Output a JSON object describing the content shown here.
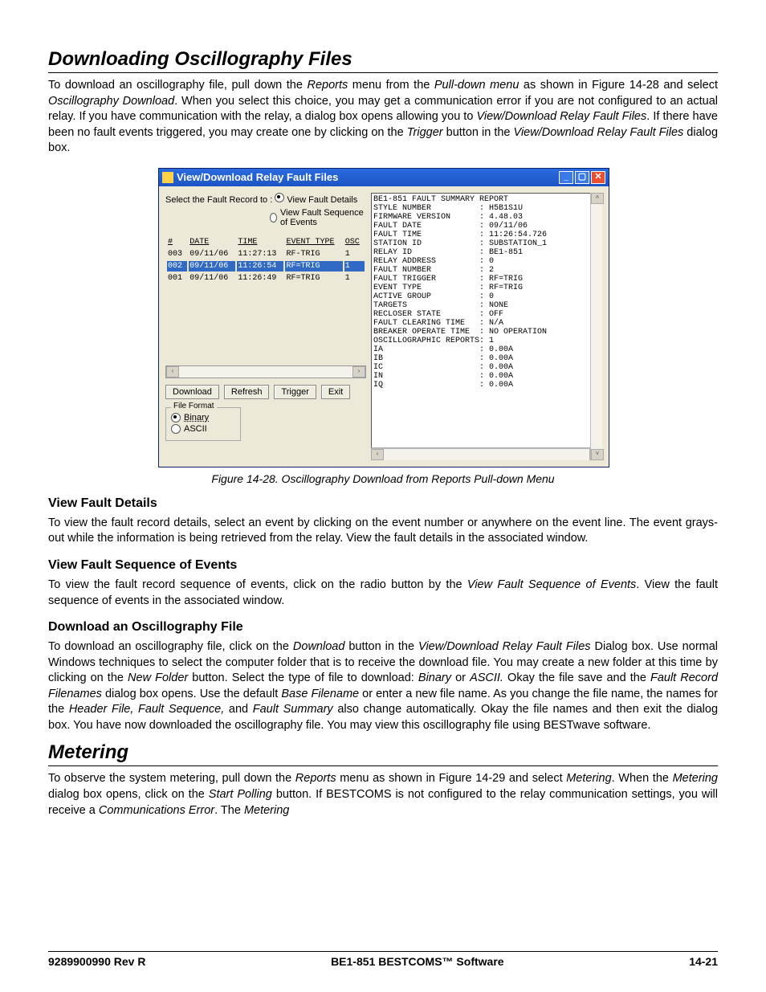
{
  "headings": {
    "h1": "Downloading Oscillography Files",
    "h2": "Metering",
    "sub1": "View Fault Details",
    "sub2": "View Fault Sequence of Events",
    "sub3": "Download an Oscillography File"
  },
  "paragraphs": {
    "intro": "To download an oscillography file, pull down the Reports menu from the Pull-down menu as shown in Figure 14-28 and select Oscillography Download. When you select this choice, you may get a communication error if you are not configured to an actual relay. If you have communication with the relay, a dialog box opens allowing you to View/Download Relay Fault Files. If there have been no fault events triggered, you may create one by clicking on the Trigger button in the View/Download Relay Fault Files dialog box.",
    "vfd": "To view the fault record details, select an event by clicking on the event number or anywhere on the event line. The event grays-out while the information is being retrieved from the relay. View the fault details in the associated window.",
    "vfse": "To view the fault record sequence of events, click on the radio button by the View Fault Sequence of Events. View the fault sequence of events in the associated window.",
    "dof": "To download an oscillography file, click on the Download button in the View/Download Relay Fault Files Dialog box. Use normal Windows techniques to select the computer folder that is to receive the download file. You may create a new folder at this time by clicking on the New Folder button. Select the type of file to download: Binary or ASCII. Okay the file save and the Fault Record Filenames dialog box opens. Use the default Base Filename or enter a new file name. As you change the file name, the names for the Header File, Fault Sequence, and Fault Summary also change automatically. Okay the file names and then exit the dialog box. You have now downloaded the oscillography file. You may view this oscillography file using BESTwave software.",
    "met": "To observe the system metering, pull down the Reports menu as shown in Figure 14-29 and select Metering. When the Metering dialog box opens, click on the Start Polling button. If BESTCOMS is not configured to the relay communication settings, you will receive a Communications Error. The Metering"
  },
  "figcaption": "Figure 14-28. Oscillography Download from Reports Pull-down Menu",
  "dialog": {
    "title": "View/Download Relay Fault Files",
    "select_label": "Select the Fault Record to :",
    "radio1": "View Fault Details",
    "radio2": "View Fault Sequence of Events",
    "cols": {
      "num": "#",
      "date": "DATE",
      "time": "TIME",
      "event": "EVENT TYPE",
      "osc": "OSC"
    },
    "rows": [
      {
        "num": "003",
        "date": "09/11/06",
        "time": "11:27:13",
        "event": "RF-TRIG",
        "osc": "1",
        "selected": false
      },
      {
        "num": "002",
        "date": "09/11/06",
        "time": "11:26:54",
        "event": "RF=TRIG",
        "osc": "1",
        "selected": true
      },
      {
        "num": "001",
        "date": "09/11/06",
        "time": "11:26:49",
        "event": "RF=TRIG",
        "osc": "1",
        "selected": false
      }
    ],
    "buttons": {
      "download": "Download",
      "refresh": "Refresh",
      "trigger": "Trigger",
      "exit": "Exit"
    },
    "file_format": {
      "legend": "File Format",
      "opt1": "Binary",
      "opt2": "ASCII"
    },
    "report": "BE1-851 FAULT SUMMARY REPORT\nSTYLE NUMBER          : H5B1S1U\nFIRMWARE VERSION      : 4.48.03\nFAULT DATE            : 09/11/06\nFAULT TIME            : 11:26:54.726\nSTATION ID            : SUBSTATION_1\nRELAY ID              : BE1-851\nRELAY ADDRESS         : 0\nFAULT NUMBER          : 2\nFAULT TRIGGER         : RF=TRIG\nEVENT TYPE            : RF=TRIG\nACTIVE GROUP          : 0\nTARGETS               : NONE\nRECLOSER STATE        : OFF\nFAULT CLEARING TIME   : N/A\nBREAKER OPERATE TIME  : NO OPERATION\nOSCILLOGRAPHIC REPORTS: 1\nIA                    : 0.00A\nIB                    : 0.00A\nIC                    : 0.00A\nIN                    : 0.00A\nIQ                    : 0.00A"
  },
  "footer": {
    "left": "9289900990 Rev R",
    "center": "BE1-851 BESTCOMS™ Software",
    "right": "14-21"
  }
}
